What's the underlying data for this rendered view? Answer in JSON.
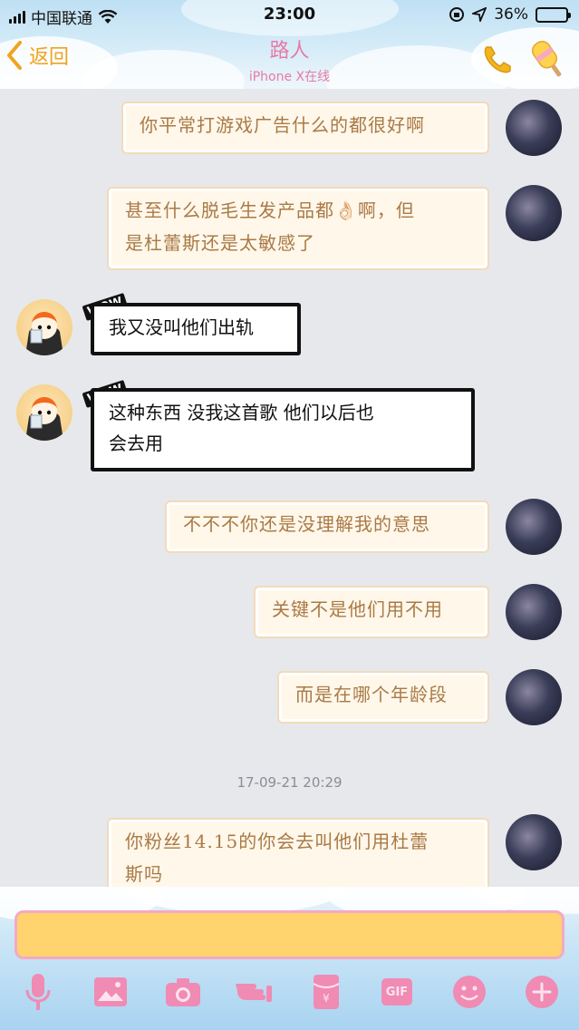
{
  "status_bar": {
    "carrier": "中国联通",
    "time": "23:00",
    "battery_percent": "36%",
    "battery_level": 0.36
  },
  "nav": {
    "back_label": "返回",
    "title": "路人",
    "subtitle": "iPhone X在线"
  },
  "messages": [
    {
      "side": "self",
      "text": "你平常打游戏广告什么的都很好啊"
    },
    {
      "side": "self",
      "text_line1": "甚至什么脱毛生发产品都👌🏻啊，但",
      "text_line2": "是杜蕾斯还是太敏感了"
    },
    {
      "side": "other",
      "text": "我又没叫他们出轨"
    },
    {
      "side": "other",
      "text_line1": "这种东西 没我这首歌 他们以后也",
      "text_line2": "会去用"
    },
    {
      "side": "self",
      "text": "不不不你还是没理解我的意思"
    },
    {
      "side": "self",
      "text": "关键不是他们用不用"
    },
    {
      "side": "self",
      "text": "而是在哪个年龄段"
    },
    {
      "side": "self",
      "text_line1": "你粉丝14.15的你会去叫他们用杜蕾",
      "text_line2": "斯吗"
    }
  ],
  "timestamp": "17-09-21 20:29",
  "wow_label": "WOW",
  "input": {
    "value": ""
  },
  "toolbar": {
    "gif_label": "GIF",
    "icons": [
      "mic-icon",
      "image-icon",
      "camera-icon",
      "poke-icon",
      "red-packet-icon",
      "gif-icon",
      "emoji-icon",
      "plus-icon"
    ]
  },
  "colors": {
    "accent_orange": "#f0a31d",
    "title_pink": "#e87aa6",
    "self_bubble_bg": "#fff7ea",
    "self_text": "#a97a45",
    "input_bg": "#ffd36e",
    "toolbar_pink": "#f08bb4"
  }
}
